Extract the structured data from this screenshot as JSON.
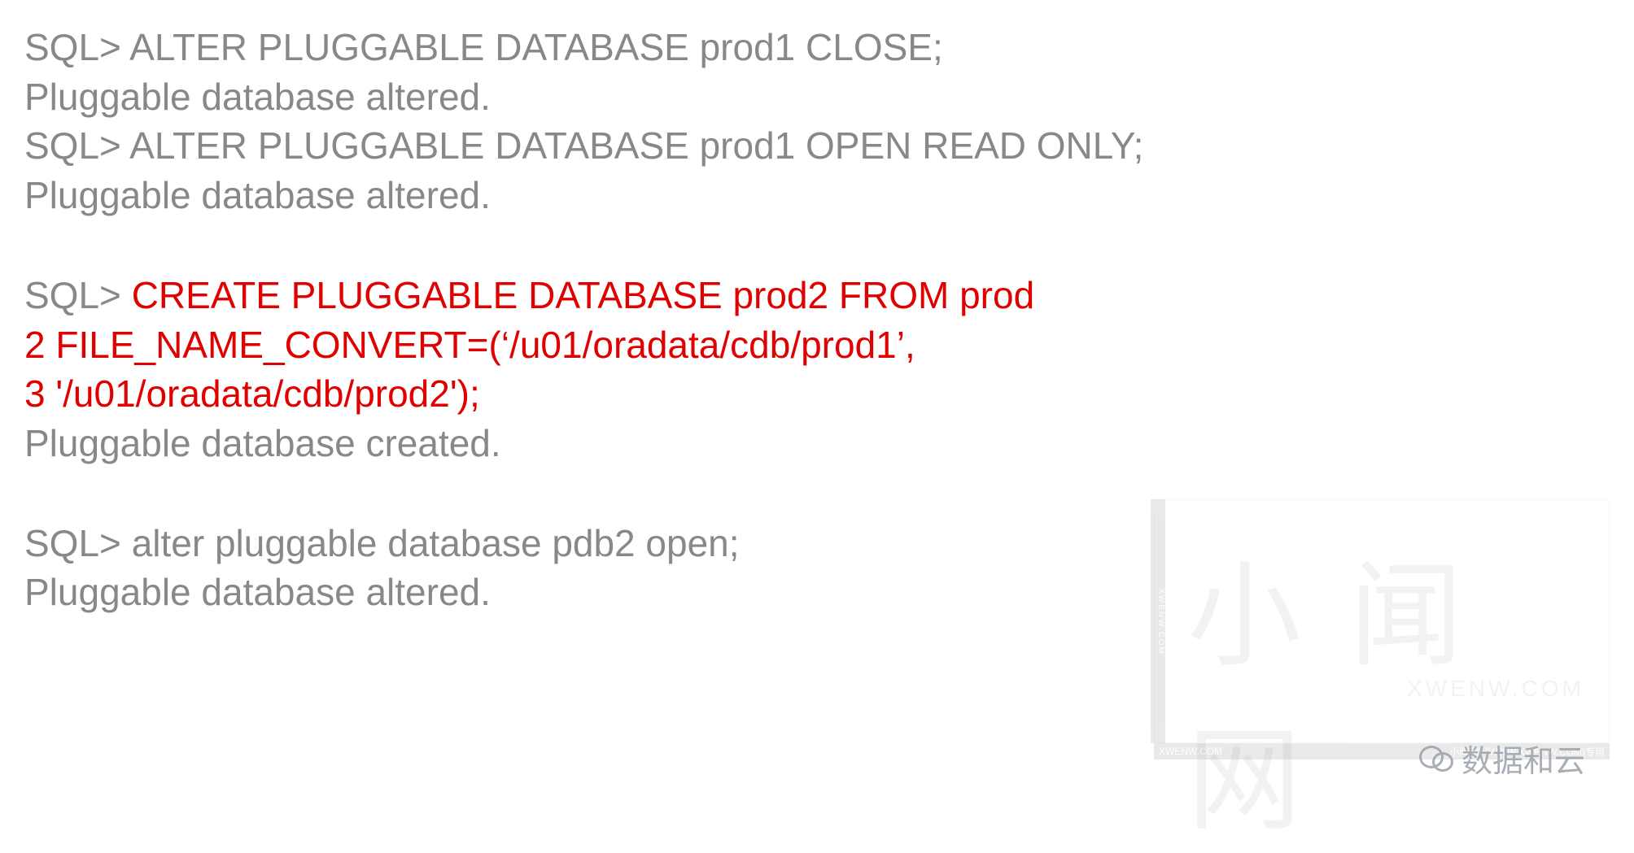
{
  "lines": [
    {
      "segments": [
        {
          "cls": "gray",
          "text": "SQL> ALTER PLUGGABLE DATABASE prod1 CLOSE;"
        }
      ]
    },
    {
      "segments": [
        {
          "cls": "gray",
          "text": "Pluggable database altered."
        }
      ]
    },
    {
      "segments": [
        {
          "cls": "gray",
          "text": "SQL> ALTER PLUGGABLE DATABASE prod1 OPEN READ ONLY;"
        }
      ]
    },
    {
      "segments": [
        {
          "cls": "gray",
          "text": "Pluggable database altered."
        }
      ]
    },
    {
      "blank": true
    },
    {
      "segments": [
        {
          "cls": "gray",
          "text": "SQL> "
        },
        {
          "cls": "red",
          "text": "CREATE PLUGGABLE DATABASE prod2 FROM prod"
        }
      ]
    },
    {
      "segments": [
        {
          "cls": "red",
          "text": " 2 FILE_NAME_CONVERT=(‘/u01/oradata/cdb/prod1’,"
        }
      ]
    },
    {
      "segments": [
        {
          "cls": "red",
          "text": " 3                                               '/u01/oradata/cdb/prod2');"
        }
      ]
    },
    {
      "segments": [
        {
          "cls": "gray",
          "text": "Pluggable database created."
        }
      ]
    },
    {
      "blank": true
    },
    {
      "segments": [
        {
          "cls": "gray",
          "text": "SQL> alter pluggable database pdb2 open;"
        }
      ]
    },
    {
      "segments": [
        {
          "cls": "gray",
          "text": "Pluggable database altered."
        }
      ]
    }
  ],
  "watermark": {
    "big": "小 闻 网",
    "sub": "XWENW.COM",
    "bar_left": "XWENW.COM",
    "bar_right": "小闻网（WWW.XWENW.COM)专用",
    "side": "XWENW.COM"
  },
  "footer_brand": "数据和云"
}
